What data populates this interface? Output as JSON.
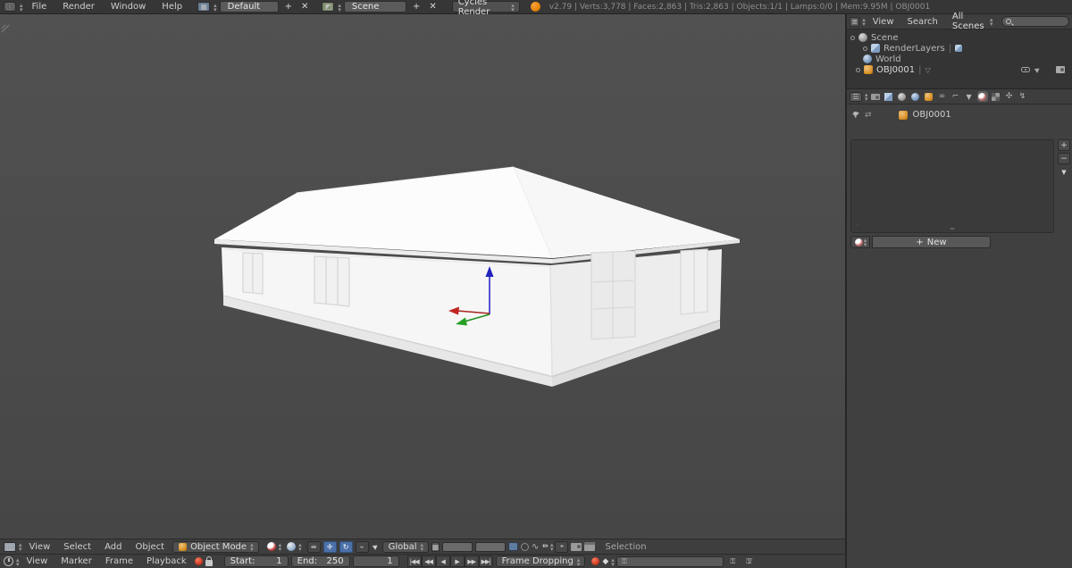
{
  "colors": {
    "accent_blue": "#4b71a8",
    "blender_orange": "#e8860c",
    "axis_x": "#c2241f",
    "axis_y": "#25a125",
    "axis_z": "#2c2cc9"
  },
  "topbar": {
    "menus": {
      "file": "File",
      "render": "Render",
      "window": "Window",
      "help": "Help"
    },
    "layout": {
      "value": "Default",
      "add": "+",
      "close": "✕"
    },
    "scene": {
      "value": "Scene",
      "add": "+",
      "close": "✕"
    },
    "engine": "Cycles Render",
    "stats": "v2.79 | Verts:3,778 | Faces:2,863 | Tris:2,863 | Objects:1/1 | Lamps:0/0 | Mem:9.95M | OBJ0001"
  },
  "outliner": {
    "menus": {
      "view": "View",
      "search": "Search"
    },
    "display_filter": "All Scenes",
    "tree": {
      "scene": "Scene",
      "renderlayers": "RenderLayers",
      "world": "World",
      "object": "OBJ0001"
    }
  },
  "properties": {
    "context_object": "OBJ0001",
    "slot_add": "+",
    "slot_remove": "−",
    "new_button": "New",
    "new_plus": "+"
  },
  "view3d": {
    "menus": {
      "view": "View",
      "select": "Select",
      "add": "Add",
      "object": "Object"
    },
    "mode": "Object Mode",
    "orientation": "Global",
    "status": "Selection"
  },
  "timeline": {
    "menus": {
      "view": "View",
      "marker": "Marker",
      "frame": "Frame",
      "playback": "Playback"
    },
    "start_label": "Start:",
    "start_value": "1",
    "end_label": "End:",
    "end_value": "250",
    "current_frame": "1",
    "sync": "Frame Dropping",
    "controls": {
      "jump_start": "|◀◀",
      "prev_key": "◀◀",
      "play_rev": "◀",
      "play": "▶",
      "next_key": "▶▶",
      "jump_end": "▶▶|"
    },
    "keying_diamond": "◆"
  },
  "icons": {
    "dropdown_arrows": "⬍",
    "search": "magnifier",
    "data_triangle": "▼"
  }
}
